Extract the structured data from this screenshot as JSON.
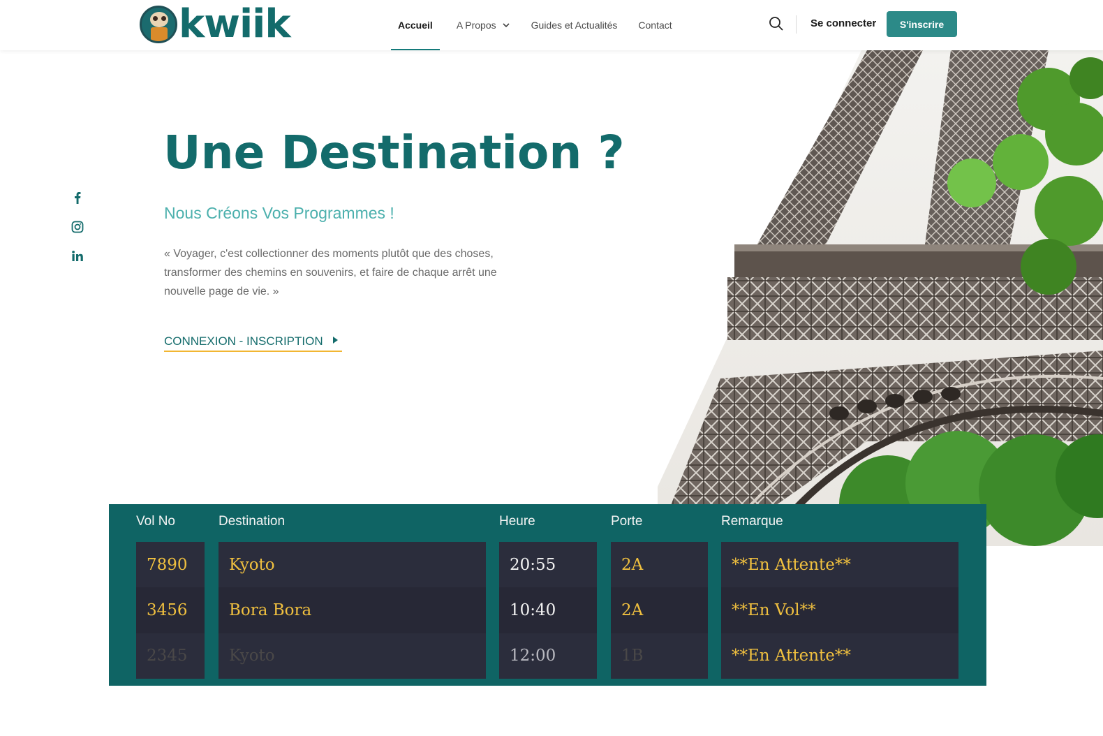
{
  "brand": {
    "name": "kwiik"
  },
  "nav": {
    "items": [
      {
        "label": "Accueil"
      },
      {
        "label": "A Propos"
      },
      {
        "label": "Guides et Actualités"
      },
      {
        "label": "Contact"
      }
    ],
    "login_label": "Se connecter",
    "signup_label": "S'inscrire"
  },
  "hero": {
    "title": "Une Destination ?",
    "subtitle": "Nous Créons Vos Programmes !",
    "quote": "« Voyager, c'est collectionner des moments plutôt que des choses, transformer des chemins en souvenirs, et faire de chaque arrêt une nouvelle page de vie. »",
    "cta_label": "CONNEXION - INSCRIPTION"
  },
  "social": [
    "facebook-icon",
    "instagram-icon",
    "linkedin-icon"
  ],
  "board": {
    "headers": {
      "vol": "Vol No",
      "destination": "Destination",
      "heure": "Heure",
      "porte": "Porte",
      "remarque": "Remarque"
    },
    "rows": [
      {
        "vol": "7890",
        "destination": "Kyoto",
        "heure": "20:55",
        "porte": "2A",
        "remarque": "**En Attente**"
      },
      {
        "vol": "3456",
        "destination": "Bora Bora",
        "heure": "10:40",
        "porte": "2A",
        "remarque": "**En Vol**"
      },
      {
        "vol": "2345",
        "destination": "Kyoto",
        "heure": "12:00",
        "porte": "1B",
        "remarque": "**En Attente**"
      }
    ]
  },
  "colors": {
    "primary": "#136b6b",
    "accent": "#2c8a88",
    "subtitle": "#4cb0ad",
    "cta_underline": "#f2b632",
    "board_bg": "#0f6464",
    "board_cell": "#2b2d3c",
    "board_text": "#f0c03f"
  }
}
